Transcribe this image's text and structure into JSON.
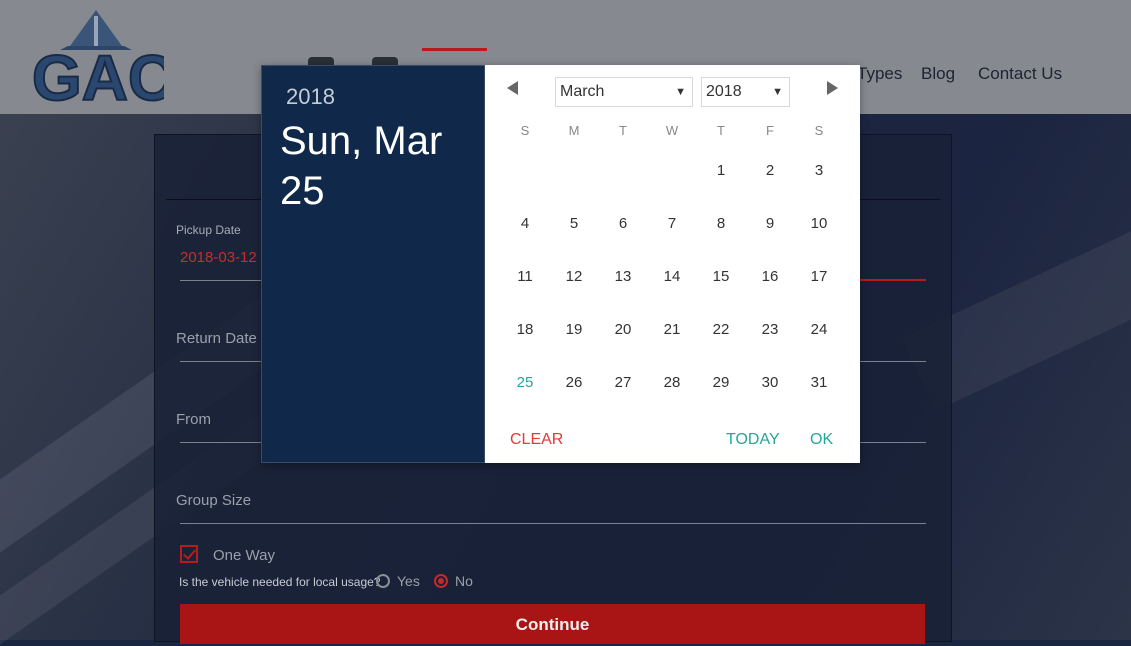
{
  "header": {
    "logo_text": "GAC",
    "nav": [
      {
        "label": "Types"
      },
      {
        "label": "Blog"
      },
      {
        "label": "Contact Us"
      }
    ],
    "social_icons": [
      "facebook-icon",
      "twitter-icon"
    ]
  },
  "form": {
    "pickup_label": "Pickup Date",
    "pickup_value": "2018-03-12",
    "return_placeholder": "Return Date",
    "from_placeholder": "From",
    "group_size_placeholder": "Group Size",
    "one_way_label": "One Way",
    "one_way_checked": true,
    "local_usage_question": "Is the vehicle needed for local usage?",
    "yes_label": "Yes",
    "no_label": "No",
    "local_usage_selected": "No",
    "continue_label": "Continue"
  },
  "datepicker": {
    "header_year": "2018",
    "header_date": "Sun, Mar 25",
    "month_select": "March",
    "year_select": "2018",
    "weekdays": [
      "S",
      "M",
      "T",
      "W",
      "T",
      "F",
      "S"
    ],
    "weeks": [
      [
        "",
        "",
        "",
        "",
        "1",
        "2",
        "3"
      ],
      [
        "4",
        "5",
        "6",
        "7",
        "8",
        "9",
        "10"
      ],
      [
        "11",
        "12",
        "13",
        "14",
        "15",
        "16",
        "17"
      ],
      [
        "18",
        "19",
        "20",
        "21",
        "22",
        "23",
        "24"
      ],
      [
        "25",
        "26",
        "27",
        "28",
        "29",
        "30",
        "31"
      ]
    ],
    "selected_day": "25",
    "clear_label": "CLEAR",
    "today_label": "TODAY",
    "ok_label": "OK"
  },
  "colors": {
    "accent_red": "#b71c1c",
    "picker_header": "#10284a",
    "teal": "#26a69a"
  }
}
